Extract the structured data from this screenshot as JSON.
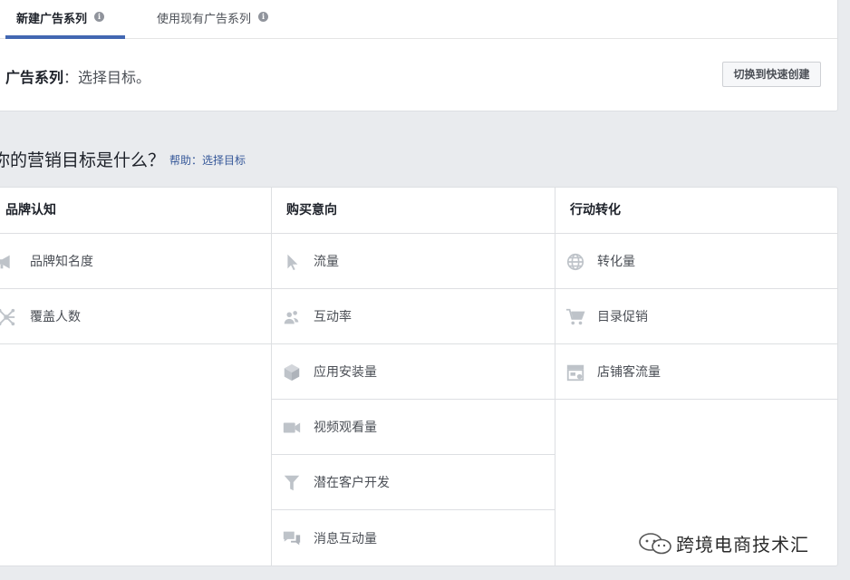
{
  "tabs": [
    {
      "label": "新建广告系列",
      "active": true
    },
    {
      "label": "使用现有广告系列",
      "active": false
    }
  ],
  "campaign": {
    "bold": "广告系列",
    "rest": "：选择目标。",
    "quick_create": "切换到快速创建"
  },
  "question": {
    "text": "你的营销目标是什么？",
    "help": "帮助：选择目标"
  },
  "columns": [
    {
      "header": "品牌认知",
      "items": [
        {
          "label": "品牌知名度",
          "icon": "megaphone-icon"
        },
        {
          "label": "覆盖人数",
          "icon": "network-icon"
        }
      ]
    },
    {
      "header": "购买意向",
      "items": [
        {
          "label": "流量",
          "icon": "cursor-icon"
        },
        {
          "label": "互动率",
          "icon": "people-icon"
        },
        {
          "label": "应用安装量",
          "icon": "box-icon"
        },
        {
          "label": "视频观看量",
          "icon": "video-camera-icon"
        },
        {
          "label": "潜在客户开发",
          "icon": "funnel-icon"
        },
        {
          "label": "消息互动量",
          "icon": "chat-bubbles-icon"
        }
      ]
    },
    {
      "header": "行动转化",
      "items": [
        {
          "label": "转化量",
          "icon": "globe-icon"
        },
        {
          "label": "目录促销",
          "icon": "shopping-cart-icon"
        },
        {
          "label": "店铺客流量",
          "icon": "storefront-icon"
        }
      ]
    }
  ],
  "watermark": {
    "text": "跨境电商技术汇",
    "icon": "wechat-icon"
  },
  "colors": {
    "accent": "#4267b2",
    "link": "#365899",
    "icon_gray": "#bec3c9"
  }
}
